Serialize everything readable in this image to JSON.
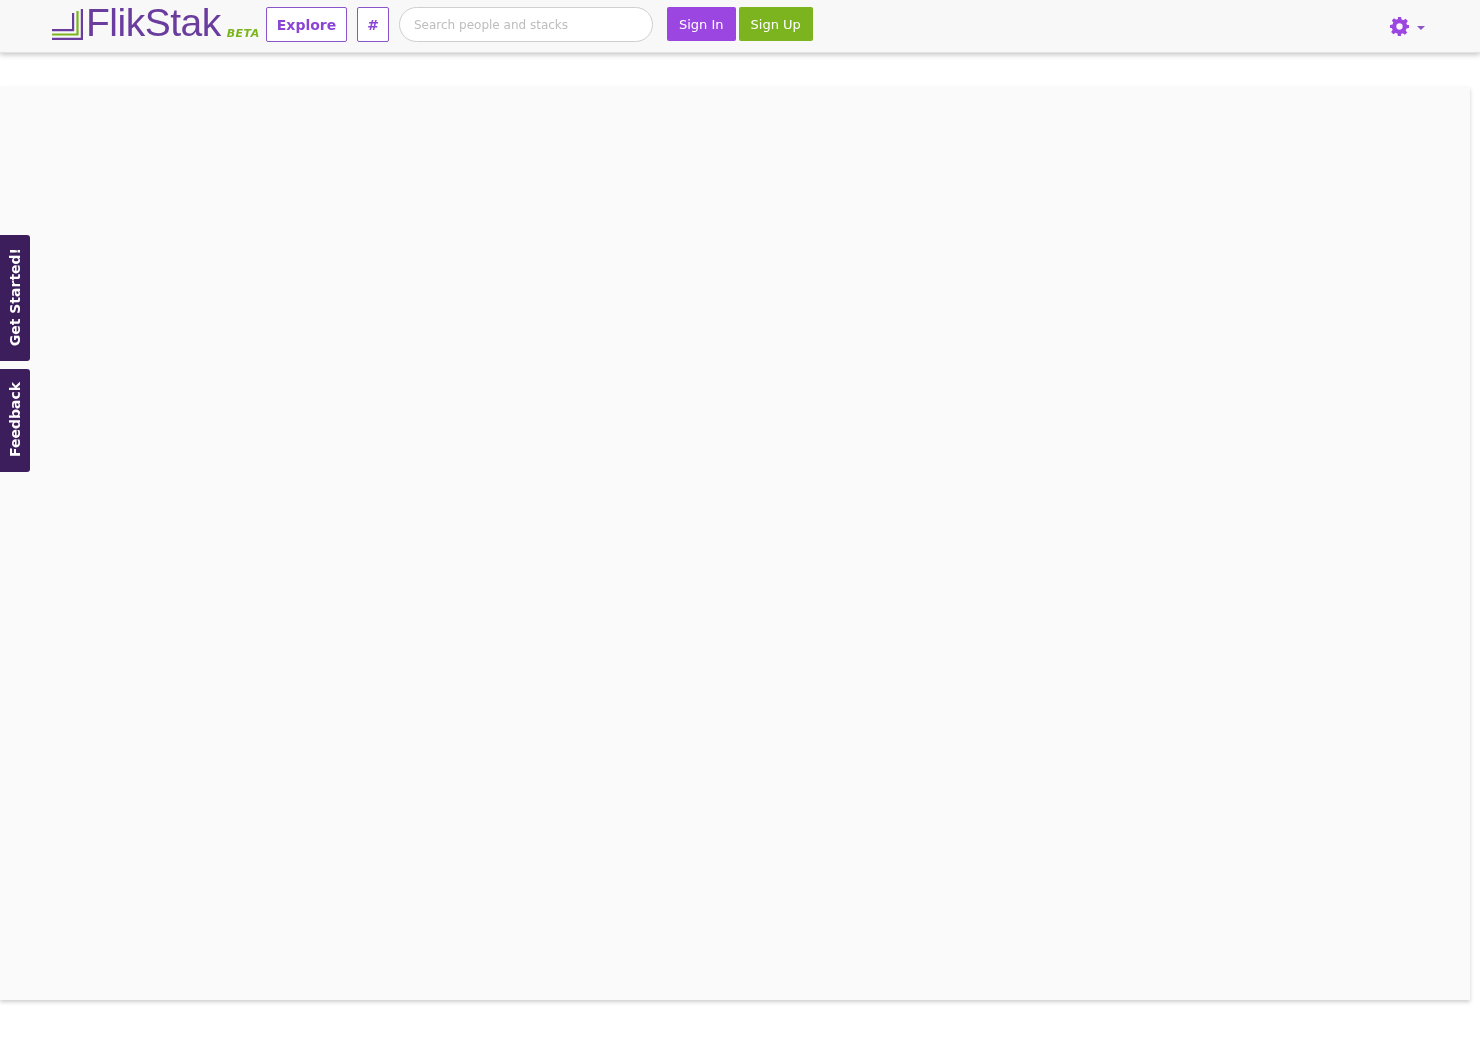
{
  "header": {
    "logo": {
      "name": "FlikStak",
      "badge": "BETA"
    },
    "nav_buttons": [
      "Explore",
      "#"
    ],
    "search": {
      "placeholder": "Search people and stacks"
    },
    "auth_buttons": [
      {
        "label": "Sign In",
        "kind": "primary"
      },
      {
        "label": "Sign Up",
        "kind": "success"
      }
    ]
  },
  "side_tabs": [
    "Get Started!",
    "Feedback"
  ]
}
